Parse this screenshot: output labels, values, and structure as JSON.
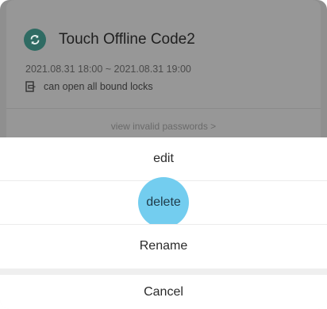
{
  "card": {
    "title": "Touch Offline Code2",
    "time_range": "2021.08.31 18:00 ~ 2021.08.31 19:00",
    "lock_scope": "can open all bound locks",
    "invalid_link": "view invalid passwords >",
    "badge_icon": "sync-icon",
    "lock_icon": "lock-door-icon",
    "badge_color": "#2f6b63"
  },
  "action_sheet": {
    "items": [
      {
        "label": "edit"
      },
      {
        "label": "delete"
      },
      {
        "label": "Rename"
      }
    ],
    "cancel": "Cancel",
    "highlight_color": "#73cdef"
  }
}
